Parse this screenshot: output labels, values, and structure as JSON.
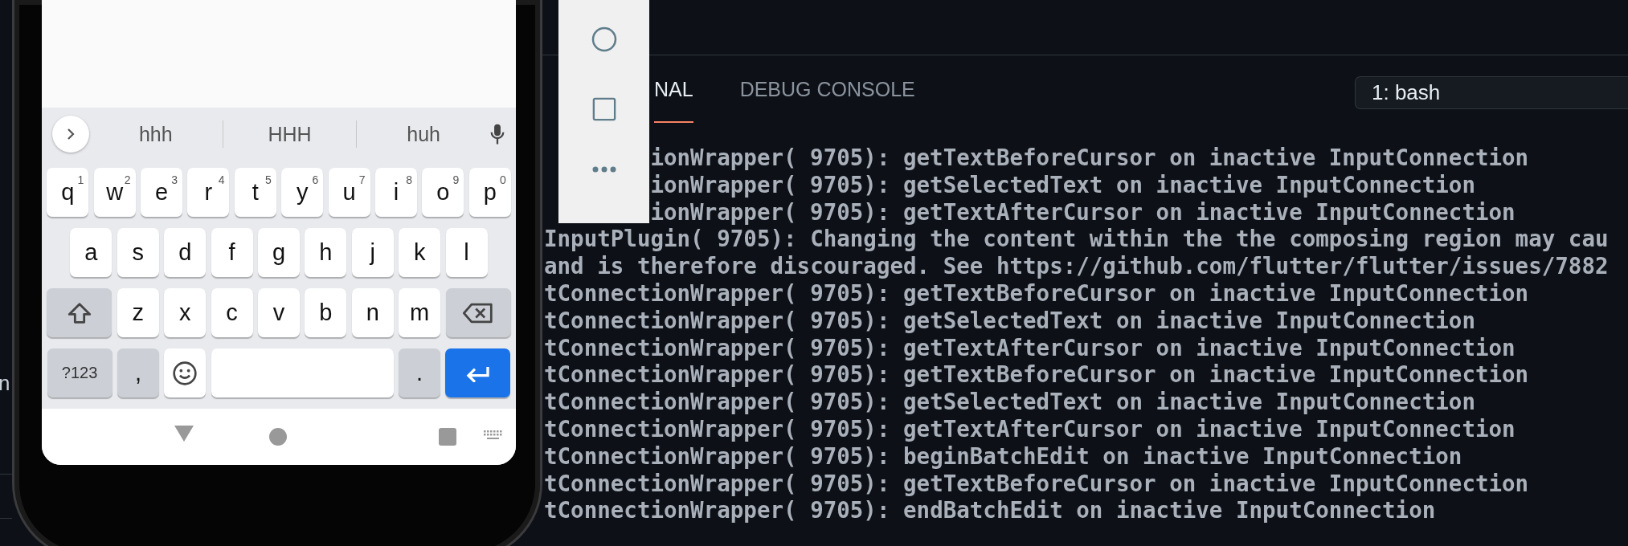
{
  "editor_edge": {
    "text": "n"
  },
  "phone": {
    "suggestions": [
      {
        "text": "hhh"
      },
      {
        "text": "HHH"
      },
      {
        "text": "huh"
      }
    ],
    "keyboard": {
      "key_rows": [
        {
          "keys": [
            {
              "kind": "letter",
              "label": "q",
              "hint": "1"
            },
            {
              "kind": "letter",
              "label": "w",
              "hint": "2"
            },
            {
              "kind": "letter",
              "label": "e",
              "hint": "3"
            },
            {
              "kind": "letter",
              "label": "r",
              "hint": "4"
            },
            {
              "kind": "letter",
              "label": "t",
              "hint": "5"
            },
            {
              "kind": "letter",
              "label": "y",
              "hint": "6"
            },
            {
              "kind": "letter",
              "label": "u",
              "hint": "7"
            },
            {
              "kind": "letter",
              "label": "i",
              "hint": "8"
            },
            {
              "kind": "letter",
              "label": "o",
              "hint": "9"
            },
            {
              "kind": "letter",
              "label": "p",
              "hint": "0"
            }
          ]
        },
        {
          "keys": [
            {
              "kind": "letter",
              "label": "a"
            },
            {
              "kind": "letter",
              "label": "s"
            },
            {
              "kind": "letter",
              "label": "d"
            },
            {
              "kind": "letter",
              "label": "f"
            },
            {
              "kind": "letter",
              "label": "g"
            },
            {
              "kind": "letter",
              "label": "h"
            },
            {
              "kind": "letter",
              "label": "j"
            },
            {
              "kind": "letter",
              "label": "k"
            },
            {
              "kind": "letter",
              "label": "l"
            }
          ]
        },
        {
          "keys": [
            {
              "kind": "shift"
            },
            {
              "kind": "letter",
              "label": "z"
            },
            {
              "kind": "letter",
              "label": "x"
            },
            {
              "kind": "letter",
              "label": "c"
            },
            {
              "kind": "letter",
              "label": "v"
            },
            {
              "kind": "letter",
              "label": "b"
            },
            {
              "kind": "letter",
              "label": "n"
            },
            {
              "kind": "letter",
              "label": "m"
            },
            {
              "kind": "backspace"
            }
          ]
        },
        {
          "keys": [
            {
              "kind": "symbols",
              "label": "?123"
            },
            {
              "kind": "punct",
              "label": ","
            },
            {
              "kind": "emoji"
            },
            {
              "kind": "space"
            },
            {
              "kind": "punct",
              "label": "."
            },
            {
              "kind": "enter"
            }
          ]
        }
      ]
    }
  },
  "terminal": {
    "tabs": [
      {
        "label": "NAL",
        "selected": true
      },
      {
        "label": "DEBUG CONSOLE",
        "selected": false
      }
    ],
    "shell_select": {
      "value": "1: bash"
    },
    "lines": [
      {
        "kind": "covered",
        "text": "ionWrapper( 9705): getTextBeforeCursor on inactive InputConnection"
      },
      {
        "kind": "covered",
        "text": "ionWrapper( 9705): getSelectedText on inactive InputConnection"
      },
      {
        "kind": "covered",
        "text": "ionWrapper( 9705): getTextAfterCursor on inactive InputConnection"
      },
      {
        "kind": "plain",
        "text": "InputPlugin( 9705): Changing the content within the the composing region may cau"
      },
      {
        "kind": "plain",
        "text": "and is therefore discouraged. See https://github.com/flutter/flutter/issues/7882"
      },
      {
        "kind": "plain",
        "text": "tConnectionWrapper( 9705): getTextBeforeCursor on inactive InputConnection"
      },
      {
        "kind": "plain",
        "text": "tConnectionWrapper( 9705): getSelectedText on inactive InputConnection"
      },
      {
        "kind": "plain",
        "text": "tConnectionWrapper( 9705): getTextAfterCursor on inactive InputConnection"
      },
      {
        "kind": "plain",
        "text": "tConnectionWrapper( 9705): getTextBeforeCursor on inactive InputConnection"
      },
      {
        "kind": "plain",
        "text": "tConnectionWrapper( 9705): getSelectedText on inactive InputConnection"
      },
      {
        "kind": "plain",
        "text": "tConnectionWrapper( 9705): getTextAfterCursor on inactive InputConnection"
      },
      {
        "kind": "plain",
        "text": "tConnectionWrapper( 9705): beginBatchEdit on inactive InputConnection"
      },
      {
        "kind": "plain",
        "text": "tConnectionWrapper( 9705): getTextBeforeCursor on inactive InputConnection"
      },
      {
        "kind": "plain",
        "text": "tConnectionWrapper( 9705): endBatchEdit on inactive InputConnection"
      }
    ]
  }
}
